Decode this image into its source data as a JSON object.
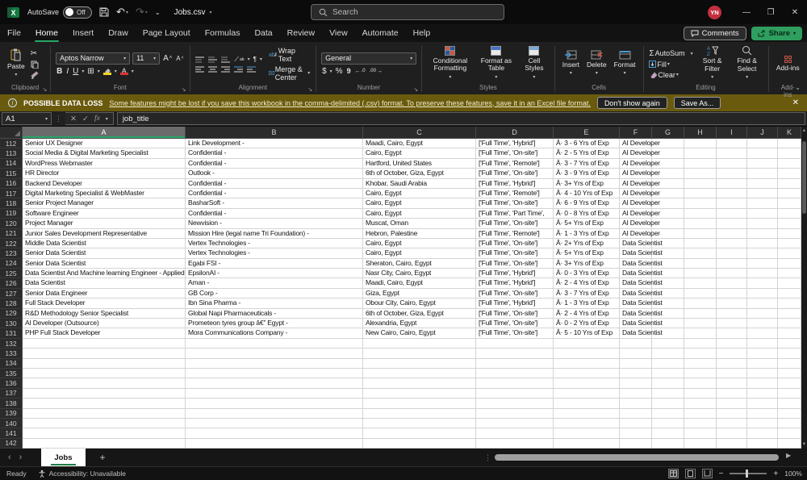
{
  "titlebar": {
    "autosave_label": "AutoSave",
    "autosave_state": "Off",
    "filename": "Jobs.csv",
    "search_placeholder": "Search",
    "user_initials": "YN",
    "minimize": "—",
    "restore": "❐",
    "close": "✕"
  },
  "menu": {
    "tabs": [
      "File",
      "Home",
      "Insert",
      "Draw",
      "Page Layout",
      "Formulas",
      "Data",
      "Review",
      "View",
      "Automate",
      "Help"
    ],
    "active": "Home",
    "comments_label": "Comments",
    "share_label": "Share"
  },
  "ribbon": {
    "clipboard": {
      "label": "Clipboard",
      "paste": "Paste"
    },
    "font": {
      "label": "Font",
      "font_name": "Aptos Narrow",
      "font_size": "11",
      "bold": "B",
      "italic": "I",
      "underline": "U"
    },
    "alignment": {
      "label": "Alignment",
      "wrap_text": "Wrap Text",
      "merge_center": "Merge & Center"
    },
    "number": {
      "label": "Number",
      "format": "General",
      "currency": "$",
      "percent": "%",
      "comma": "9"
    },
    "styles": {
      "label": "Styles",
      "conditional": "Conditional Formatting",
      "format_table": "Format as Table",
      "cell_styles": "Cell Styles"
    },
    "cells": {
      "label": "Cells",
      "insert": "Insert",
      "delete": "Delete",
      "format": "Format"
    },
    "editing": {
      "label": "Editing",
      "autosum": "AutoSum",
      "fill": "Fill",
      "clear": "Clear",
      "sort": "Sort & Filter",
      "find": "Find & Select"
    },
    "addins": {
      "label": "Add-ins",
      "item": "Add-ins"
    }
  },
  "warning": {
    "title": "POSSIBLE DATA LOSS",
    "message": "Some features might be lost if you save this workbook in the comma-delimited (.csv) format. To preserve these features, save it in an Excel file format.",
    "dismiss_label": "Don't show again",
    "save_as_label": "Save As...",
    "close": "✕"
  },
  "formula_bar": {
    "name_box": "A1",
    "cancel": "✕",
    "enter": "✓",
    "fx": "fx",
    "content": "job_title"
  },
  "grid": {
    "columns": [
      "A",
      "B",
      "C",
      "D",
      "E",
      "F",
      "G",
      "H",
      "I",
      "J",
      "K"
    ],
    "selected_column": "A",
    "rows": [
      {
        "n": 112,
        "cells": [
          "Senior UX Designer",
          "Link Development -",
          "Maadi, Cairo, Egypt",
          "['Full Time', 'Hybrid']",
          "Â· 3 - 6 Yrs of Exp",
          "AI Developer"
        ]
      },
      {
        "n": 113,
        "cells": [
          "Social Media & Digital Marketing Specialist",
          "Confidential -",
          "Cairo, Egypt",
          "['Full Time', 'On-site']",
          "Â· 2 - 5 Yrs of Exp",
          "AI Developer"
        ]
      },
      {
        "n": 114,
        "cells": [
          "WordPress Webmaster",
          "Confidential -",
          "Hartford, United States",
          "['Full Time', 'Remote']",
          "Â· 3 - 7 Yrs of Exp",
          "AI Developer"
        ]
      },
      {
        "n": 115,
        "cells": [
          "HR Director",
          "Outlook -",
          "6th of October, Giza, Egypt",
          "['Full Time', 'On-site']",
          "Â· 3 - 9 Yrs of Exp",
          "AI Developer"
        ]
      },
      {
        "n": 116,
        "cells": [
          "Backend Developer",
          "Confidential -",
          "Khobar, Saudi Arabia",
          "['Full Time', 'Hybrid']",
          "Â· 3+ Yrs of Exp",
          "AI Developer"
        ]
      },
      {
        "n": 117,
        "cells": [
          "Digital Marketing Specialist & WebMaster",
          "Confidential -",
          "Cairo, Egypt",
          "['Full Time', 'Remote']",
          "Â· 4 - 10 Yrs of Exp",
          "AI Developer"
        ]
      },
      {
        "n": 118,
        "cells": [
          "Senior Project Manager",
          "BasharSoft -",
          "Cairo, Egypt",
          "['Full Time', 'On-site']",
          "Â· 6 - 9 Yrs of Exp",
          "AI Developer"
        ]
      },
      {
        "n": 119,
        "cells": [
          "Software Engineer",
          "Confidential -",
          "Cairo, Egypt",
          "['Full Time', 'Part Time',",
          "Â· 0 - 8 Yrs of Exp",
          "AI Developer"
        ]
      },
      {
        "n": 120,
        "cells": [
          "Project Manager",
          "Newvision -",
          "Muscat, Oman",
          "['Full Time', 'On-site']",
          "Â· 5+ Yrs of Exp",
          "AI Developer"
        ]
      },
      {
        "n": 121,
        "cells": [
          "Junior Sales Development Representative",
          "Mission Hire (legal name Tri Foundation) -",
          "Hebron, Palestine",
          "['Full Time', 'Remote']",
          "Â· 1 - 3 Yrs of Exp",
          "AI Developer"
        ]
      },
      {
        "n": 122,
        "cells": [
          "Middle Data Scientist",
          "Vertex Technologies -",
          "Cairo, Egypt",
          "['Full Time', 'On-site']",
          "Â· 2+ Yrs of Exp",
          "Data Scientist"
        ]
      },
      {
        "n": 123,
        "cells": [
          "Senior Data Scientist",
          "Vertex Technologies -",
          "Cairo, Egypt",
          "['Full Time', 'On-site']",
          "Â· 5+ Yrs of Exp",
          "Data Scientist"
        ]
      },
      {
        "n": 124,
        "cells": [
          "Senior Data Scientist",
          "Egabi FSI -",
          "Sheraton, Cairo, Egypt",
          "['Full Time', 'On-site']",
          "Â· 3+ Yrs of Exp",
          "Data Scientist"
        ]
      },
      {
        "n": 125,
        "cells": [
          "Data Scientist And Machine learning Engineer - Applied A",
          "EpsilonAI -",
          "Nasr City, Cairo, Egypt",
          "['Full Time', 'Hybrid']",
          "Â· 0 - 3 Yrs of Exp",
          "Data Scientist"
        ]
      },
      {
        "n": 126,
        "cells": [
          "Data Scientist",
          "Aman -",
          "Maadi, Cairo, Egypt",
          "['Full Time', 'Hybrid']",
          "Â· 2 - 4 Yrs of Exp",
          "Data Scientist"
        ]
      },
      {
        "n": 127,
        "cells": [
          "Senior Data Engineer",
          "GB Corp -",
          "Giza, Egypt",
          "['Full Time', 'On-site']",
          "Â· 3 - 7 Yrs of Exp",
          "Data Scientist"
        ]
      },
      {
        "n": 128,
        "cells": [
          "Full Stack Developer",
          "Ibn Sina Pharma -",
          "Obour City, Cairo, Egypt",
          "['Full Time', 'Hybrid']",
          "Â· 1 - 3 Yrs of Exp",
          "Data Scientist"
        ]
      },
      {
        "n": 129,
        "cells": [
          "R&D Methodology Senior Specialist",
          "Global Napi Pharmaceuticals -",
          "6th of October, Giza, Egypt",
          "['Full Time', 'On-site']",
          "Â· 2 - 4 Yrs of Exp",
          "Data Scientist"
        ]
      },
      {
        "n": 130,
        "cells": [
          "AI Developer (Outsource)",
          "Prometeon tyres group â€” Egypt -",
          "Alexandria, Egypt",
          "['Full Time', 'On-site']",
          "Â· 0 - 2 Yrs of Exp",
          "Data Scientist"
        ]
      },
      {
        "n": 131,
        "cells": [
          "PHP Full Stack Developer",
          "Mora Communications Company -",
          "New Cairo, Cairo, Egypt",
          "['Full Time', 'On-site']",
          "Â· 5 - 10 Yrs of Exp",
          "Data Scientist"
        ]
      },
      {
        "n": 132,
        "cells": []
      },
      {
        "n": 133,
        "cells": []
      },
      {
        "n": 134,
        "cells": []
      },
      {
        "n": 135,
        "cells": []
      },
      {
        "n": 136,
        "cells": []
      },
      {
        "n": 137,
        "cells": []
      },
      {
        "n": 138,
        "cells": []
      },
      {
        "n": 139,
        "cells": []
      },
      {
        "n": 140,
        "cells": []
      },
      {
        "n": 141,
        "cells": []
      },
      {
        "n": 142,
        "cells": []
      }
    ]
  },
  "sheetbar": {
    "active_tab": "Jobs"
  },
  "statusbar": {
    "mode": "Ready",
    "accessibility": "Accessibility: Unavailable",
    "zoom": "100%"
  }
}
